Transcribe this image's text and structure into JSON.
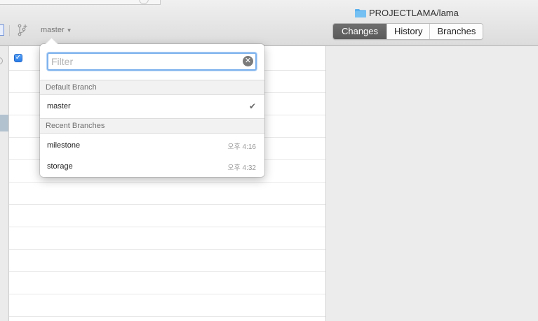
{
  "window": {
    "repo_path": "PROJECTLAMA/lama"
  },
  "toolbar": {
    "current_branch": "master"
  },
  "view_tabs": [
    {
      "label": "Changes",
      "active": true
    },
    {
      "label": "History",
      "active": false
    },
    {
      "label": "Branches",
      "active": false
    }
  ],
  "branch_dropdown": {
    "filter_placeholder": "Filter",
    "filter_value": "",
    "default_section": "Default Branch",
    "default_branch": {
      "name": "master",
      "checked": true
    },
    "recent_section": "Recent Branches",
    "recent_branches": [
      {
        "name": "milestone",
        "time": "오후 4:16"
      },
      {
        "name": "storage",
        "time": "오후 4:32"
      }
    ]
  },
  "changes": {
    "select_all_checked": true
  },
  "colors": {
    "accent": "#2a7de8",
    "active_tab": "#5f5f5f",
    "folder": "#5ab0ee"
  }
}
